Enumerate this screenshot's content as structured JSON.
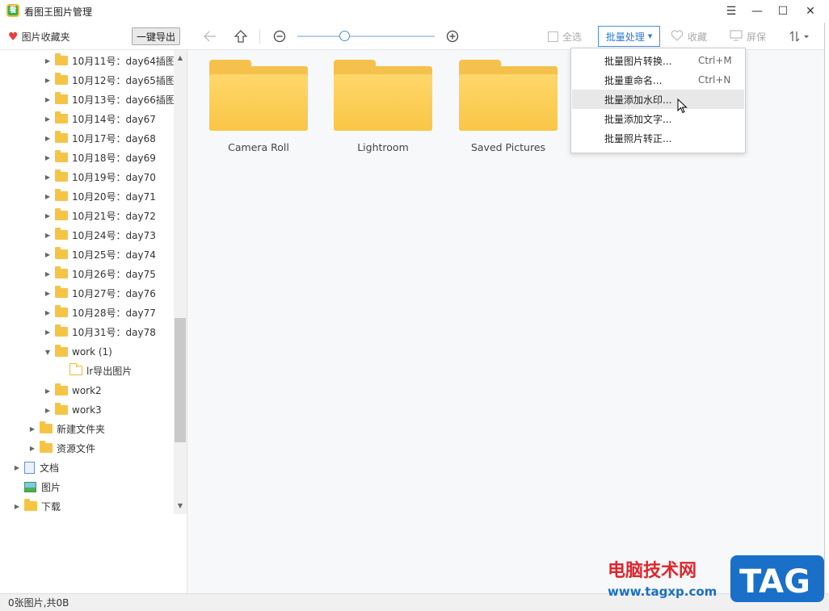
{
  "window": {
    "title": "看图王图片管理",
    "controls": {
      "menu": "☰",
      "minimize": "—",
      "maximize": "☐",
      "close": "✕"
    }
  },
  "toolbar": {
    "favorites_label": "图片收藏夹",
    "export_label": "一键导出",
    "select_all_label": "全选",
    "batch_label": "批量处理",
    "favorite_label": "收藏",
    "screen_label": "屏保",
    "zoom_level": 0.35
  },
  "sidebar": {
    "items": [
      {
        "label": "10月11号：day64插图"
      },
      {
        "label": "10月12号：day65插图"
      },
      {
        "label": "10月13号：day66插图"
      },
      {
        "label": "10月14号：day67"
      },
      {
        "label": "10月17号：day68"
      },
      {
        "label": "10月18号：day69"
      },
      {
        "label": "10月19号：day70"
      },
      {
        "label": "10月20号：day71"
      },
      {
        "label": "10月21号：day72"
      },
      {
        "label": "10月24号：day73"
      },
      {
        "label": "10月25号：day74"
      },
      {
        "label": "10月26号：day75"
      },
      {
        "label": "10月27号：day76"
      },
      {
        "label": "10月28号：day77"
      },
      {
        "label": "10月31号：day78"
      },
      {
        "label": "work (1)"
      },
      {
        "label": "lr导出图片"
      },
      {
        "label": "work2"
      },
      {
        "label": "work3"
      },
      {
        "label": "新建文件夹"
      },
      {
        "label": "资源文件"
      },
      {
        "label": "文档"
      },
      {
        "label": "图片"
      },
      {
        "label": "下载"
      }
    ]
  },
  "main": {
    "folders": [
      {
        "label": "Camera Roll"
      },
      {
        "label": "Lightroom"
      },
      {
        "label": "Saved Pictures"
      }
    ]
  },
  "batch_menu": {
    "items": [
      {
        "label": "批量图片转换...",
        "shortcut": "Ctrl+M"
      },
      {
        "label": "批量重命名...",
        "shortcut": "Ctrl+N"
      },
      {
        "label": "批量添加水印...",
        "shortcut": ""
      },
      {
        "label": "批量添加文字...",
        "shortcut": ""
      },
      {
        "label": "批量照片转正...",
        "shortcut": ""
      }
    ],
    "hovered_index": 2
  },
  "status": {
    "text": "0张图片,共0B"
  },
  "watermark": {
    "site_name": "电脑技术网",
    "url": "www.tagxp.com",
    "brand": "TAG"
  },
  "colors": {
    "accent": "#2a7ad5",
    "folder": "#f5c14c",
    "heart": "#e8403a",
    "watermark_red": "#e0262b",
    "watermark_blue": "#1a6fc9"
  }
}
